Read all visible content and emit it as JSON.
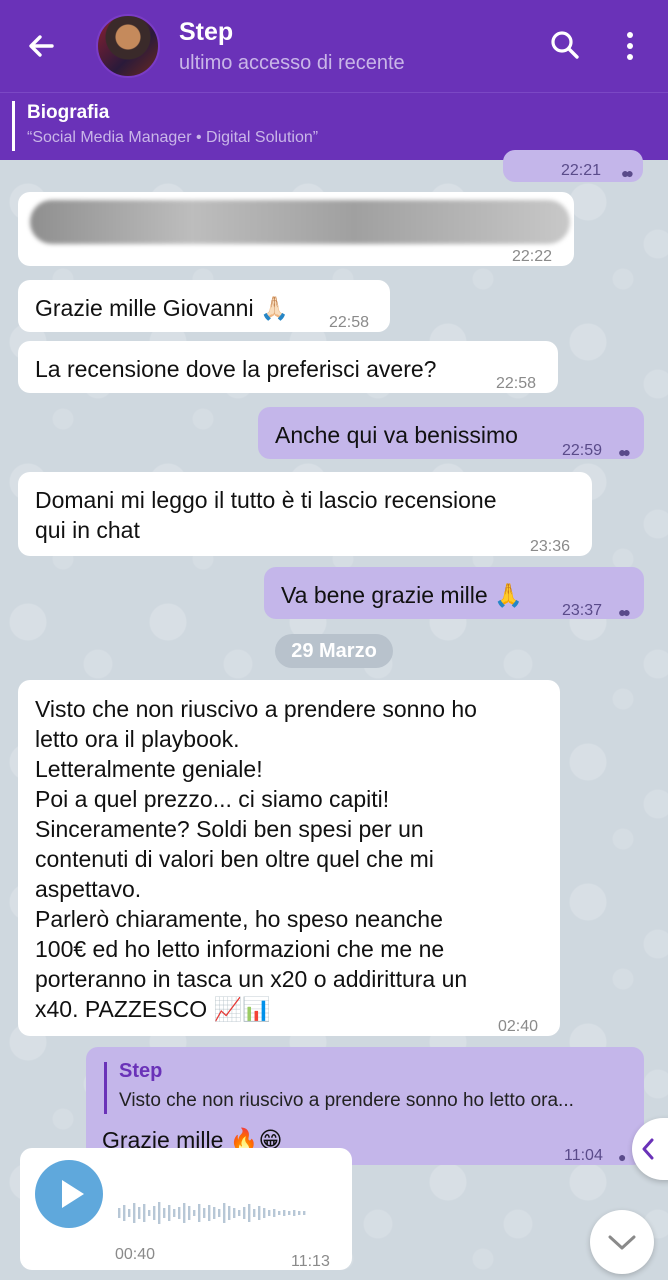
{
  "header": {
    "title": "Step",
    "subtitle": "ultimo accesso di recente",
    "bio_title": "Biografia",
    "bio_text": "“Social Media Manager • Digital Solution”"
  },
  "messages": {
    "top_out_time": "22:21",
    "blurred_time": "22:22",
    "m1_text": "Grazie mille Giovanni 🙏🏻",
    "m1_time": "22:58",
    "m2_text": "La recensione dove la preferisci avere?",
    "m2_time": "22:58",
    "m3_text": "Anche qui va benissimo",
    "m3_time": "22:59",
    "m4_line1": "Domani mi leggo il tutto è ti lascio recensione",
    "m4_line2": "qui in chat",
    "m4_time": "23:36",
    "m5_text": "Va bene grazie mille 🙏",
    "m5_time": "23:37",
    "date_divider": "29 Marzo",
    "m6_lines": [
      "Visto che non riuscivo a prendere sonno ho",
      "letto ora il playbook.",
      "Letteralmente geniale!",
      "Poi a quel prezzo... ci siamo capiti!",
      "Sinceramente? Soldi ben spesi per un",
      "contenuti di valori ben oltre quel che mi",
      "aspettavo.",
      "Parlerò chiaramente, ho speso neanche",
      "100€ ed ho letto informazioni che me ne",
      "porteranno in tasca un x20 o addirittura un",
      "x40. PAZZESCO 📈📊"
    ],
    "m6_time": "02:40",
    "reply_name": "Step",
    "reply_quote": "Visto che non riuscivo a prendere sonno ho letto ora...",
    "m7_text": "Grazie mille 🔥😁",
    "m7_time": "11:04",
    "voice_duration": "00:40",
    "voice_time": "11:13"
  },
  "icons": {
    "back": "arrow-left-icon",
    "search": "search-icon",
    "more": "more-vert-icon",
    "play": "play-icon",
    "scroll_down": "chevron-down-icon",
    "side": "chevron-left-icon"
  },
  "colors": {
    "header": "#6a32b8",
    "outgoing": "#c4b6ea",
    "incoming": "#ffffff",
    "voice_play": "#5fa8dc"
  }
}
